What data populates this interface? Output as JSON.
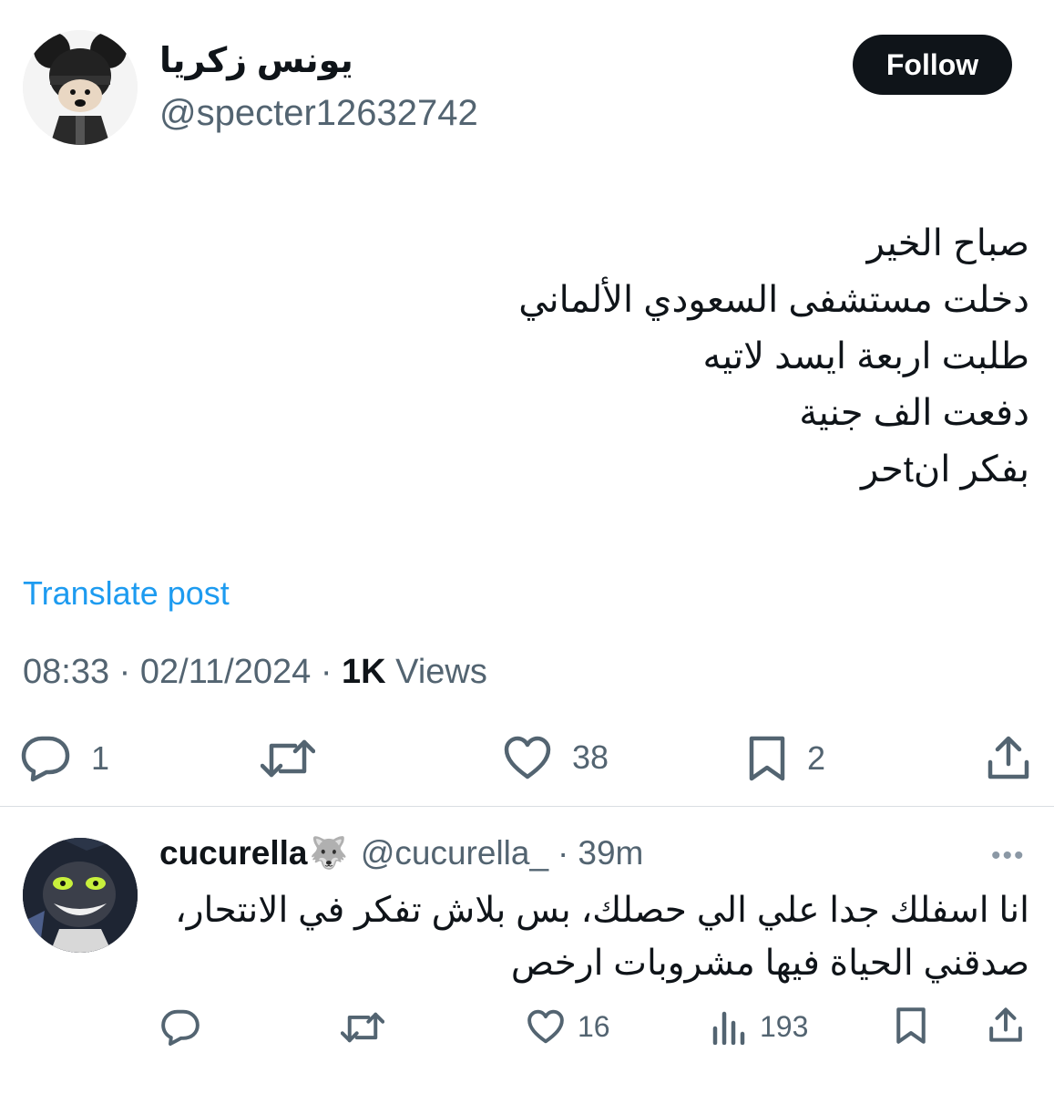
{
  "post": {
    "author": {
      "display_name": "يونس زكريا",
      "handle": "@specter12632742"
    },
    "follow_label": "Follow",
    "text_lines": [
      "صباح الخير",
      "دخلت مستشفى السعودي الألماني",
      "طلبت اربعة ايسد لاتيه",
      "دفعت الف جنية",
      "بفكر انtحر"
    ],
    "translate_label": "Translate post",
    "time": "08:33",
    "date": "02/11/2024",
    "views_count": "1K",
    "views_label": "Views",
    "actions": {
      "replies": "1",
      "reposts": "",
      "likes": "38",
      "bookmarks": "2"
    }
  },
  "reply": {
    "display_name": "cucurella",
    "name_emoji": "🐺",
    "handle": "@cucurella_",
    "time_ago": "39m",
    "text_lines": [
      "انا اسفلك جدا علي الي حصلك، بس بلاش تفكر في الانتحار،",
      "صدقني الحياة فيها مشروبات ارخص"
    ],
    "actions": {
      "replies": "",
      "reposts": "",
      "likes": "16",
      "views": "193"
    }
  },
  "icons": {
    "reply": "speech-bubble-icon",
    "repost": "repost-arrows-icon",
    "like": "heart-icon",
    "bookmark": "bookmark-icon",
    "share": "share-upload-icon",
    "views": "bar-chart-icon",
    "more": "more-dots-icon"
  },
  "colors": {
    "text": "#0f1419",
    "secondary": "#536471",
    "link": "#1d9bf0",
    "follow_bg": "#0f1419"
  }
}
